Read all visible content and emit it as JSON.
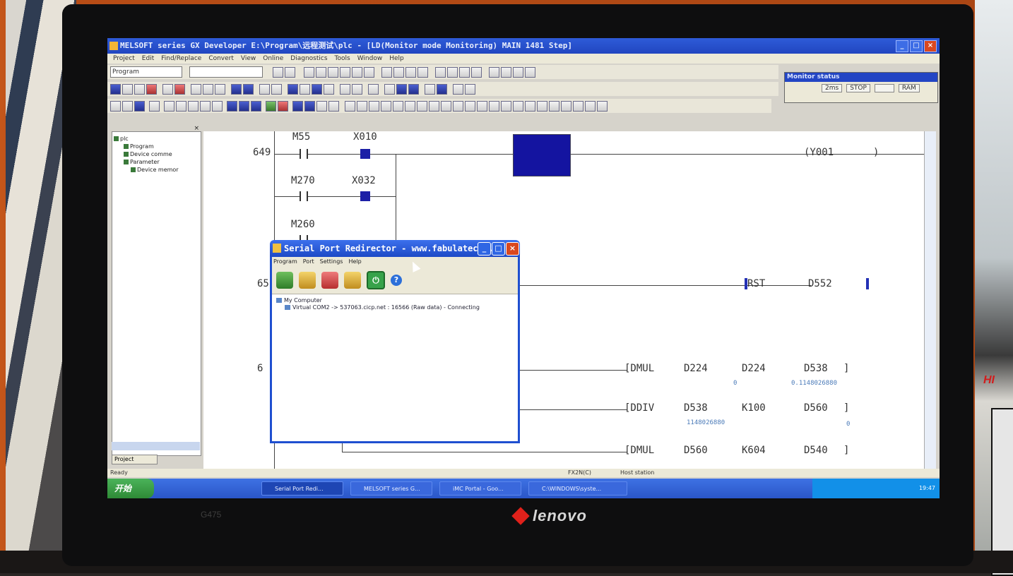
{
  "window": {
    "title": "MELSOFT series GX Developer E:\\Program\\远程测试\\plc - [LD(Monitor mode Monitoring)    MAIN    1481 Step]"
  },
  "menu": [
    "Project",
    "Edit",
    "Find/Replace",
    "Convert",
    "View",
    "Online",
    "Diagnostics",
    "Tools",
    "Window",
    "Help"
  ],
  "toolbar": {
    "program_select": "Program"
  },
  "monitor_status": {
    "title": "Monitor status",
    "scan": "2ms",
    "mode": "STOP",
    "memory": "RAM"
  },
  "project_tree": {
    "root": "plc",
    "items": [
      "Program",
      "Device comme",
      "Parameter",
      "Device memor"
    ],
    "tab": "Project"
  },
  "ladder": {
    "rungs": {
      "r649": {
        "step": "649",
        "m55": "M55",
        "x010": "X010",
        "m270": "M270",
        "x032": "X032",
        "m260": "M260",
        "coil": "(Y001",
        "coil_end": ")"
      },
      "r65x": {
        "step": "65",
        "instr": "RST",
        "op": "D552"
      },
      "r6xx": {
        "step": "6"
      },
      "dmul1": {
        "instr": "[DMUL",
        "a": "D224",
        "b": "D224",
        "c": "D538",
        "a_val": "0",
        "c_val": "0.1148026880"
      },
      "ddiv": {
        "instr": "[DDIV",
        "a": "D538",
        "b": "K100",
        "c": "D560",
        "a_val": "1148026880",
        "c_val": "0"
      },
      "dmul2": {
        "instr": "[DMUL",
        "a": "D560",
        "b": "K604",
        "c": "D540"
      }
    }
  },
  "statusbar": {
    "left": "Ready",
    "mid1": "FX2N(C)",
    "mid2": "Host station"
  },
  "taskbar": {
    "start": "开始",
    "tasks": [
      "Serial Port Redi...",
      "MELSOFT series G...",
      "iMC Portal - Goo...",
      "C:\\WINDOWS\\syste..."
    ],
    "clock": "19:47"
  },
  "serial_dialog": {
    "title": "Serial Port Redirector - www.fabulatec...",
    "menu": [
      "Program",
      "Port",
      "Settings",
      "Help"
    ],
    "tree_root": "My Computer",
    "connection": "Virtual COM2 -> 537063.cicp.net : 16566 (Raw data) - Connecting"
  },
  "laptop": {
    "brand": "lenovo",
    "model": "G475"
  },
  "monitor_label": "HI"
}
